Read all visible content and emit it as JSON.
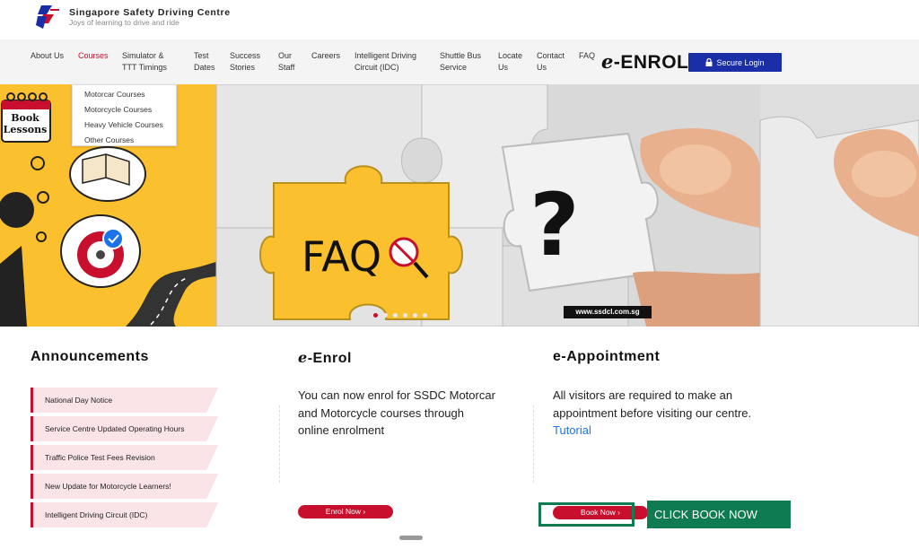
{
  "brand": {
    "name": "Singapore Safety Driving Centre",
    "tagline": "Joys of learning to drive and ride"
  },
  "nav": {
    "items": [
      {
        "label": "About Us"
      },
      {
        "label": "Courses"
      },
      {
        "label": "Simulator & TTT Timings"
      },
      {
        "label": "Test Dates"
      },
      {
        "label": "Success Stories"
      },
      {
        "label": "Our Staff"
      },
      {
        "label": "Careers"
      },
      {
        "label": "Intelligent Driving Circuit (IDC)"
      },
      {
        "label": "Shuttle Bus Service"
      },
      {
        "label": "Locate Us"
      },
      {
        "label": "Contact Us"
      },
      {
        "label": "FAQ"
      }
    ],
    "active": "Courses",
    "enrol_logo_prefix": "e",
    "enrol_logo_text": "-ENROL",
    "secure_login": "Secure Login"
  },
  "courses_dropdown": [
    "Motorcar Courses",
    "Motorcycle Courses",
    "Heavy Vehicle Courses",
    "Other Courses"
  ],
  "hero": {
    "book_lessons_line1": "Book",
    "book_lessons_line2": "Lessons",
    "faq_text": "FAQ",
    "question_mark": "?",
    "url": "www.ssdcl.com.sg",
    "slide_count": 6,
    "active_slide": 1
  },
  "announcements": {
    "title": "Announcements",
    "items": [
      "National Day Notice",
      "Service Centre Updated Operating Hours",
      "Traffic Police Test Fees Revision",
      "New Update for Motorcycle Learners!",
      "Intelligent Driving Circuit (IDC)"
    ]
  },
  "eenrol": {
    "title_prefix": "e",
    "title_suffix": "-Enrol",
    "text": "You can now enrol for SSDC Motorcar and Motorcycle courses through online enrolment",
    "button": "Enrol Now ›"
  },
  "eappointment": {
    "title": "e-Appointment",
    "text": "All visitors are required to make an appointment before visiting our centre.",
    "link": "Tutorial",
    "button": "Book Now ›"
  },
  "callout": "CLICK BOOK NOW",
  "colors": {
    "brand_red": "#c8102e",
    "login_blue": "#1a2ea8",
    "callout_green": "#0f7b50",
    "hero_yellow": "#fbc02d"
  }
}
